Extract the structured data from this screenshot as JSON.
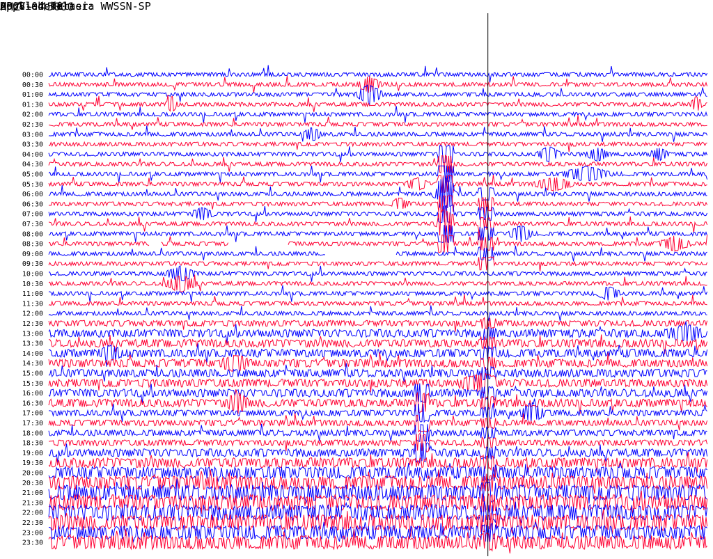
{
  "header": {
    "station": "HP Vlahokerasia",
    "date": "2008-04-08",
    "filter": "Applied filter: WWSSN-SP"
  },
  "channel_label": "HHZ - 45000",
  "colors": {
    "trace_a": "#0000ff",
    "trace_b": "#ff0033",
    "marker": "#000000"
  },
  "chart_data": {
    "type": "line",
    "title": "HP Vlahokerasia",
    "ylabel": "HHZ - 45000",
    "y_tick_labels": [
      "00:00",
      "00:30",
      "01:00",
      "01:30",
      "02:00",
      "02:30",
      "03:00",
      "03:30",
      "04:00",
      "04:30",
      "05:00",
      "05:30",
      "06:00",
      "06:30",
      "07:00",
      "07:30",
      "08:00",
      "08:30",
      "09:00",
      "09:30",
      "10:00",
      "10:30",
      "11:00",
      "11:30",
      "12:00",
      "12:30",
      "13:00",
      "13:30",
      "14:00",
      "14:30",
      "15:00",
      "15:30",
      "16:00",
      "16:30",
      "17:00",
      "17:30",
      "18:00",
      "18:30",
      "19:00",
      "19:30",
      "20:00",
      "20:30",
      "21:00",
      "21:30",
      "22:00",
      "22:30",
      "23:00",
      "23:30"
    ],
    "x_range_minutes": [
      0,
      30
    ],
    "rows": 48,
    "alternate_colors": [
      "#0000ff",
      "#ff0033"
    ],
    "noise_by_row": [
      2,
      2,
      2,
      2,
      2,
      2,
      2,
      2,
      2,
      2,
      2,
      2,
      2,
      2,
      2,
      2,
      2,
      2,
      2,
      2,
      2,
      2,
      2,
      2,
      2,
      3,
      4,
      4,
      4,
      4,
      4,
      4,
      4,
      4,
      3,
      3,
      3,
      3,
      4,
      5,
      6,
      7,
      8,
      8,
      8,
      8,
      7,
      7
    ],
    "events": [
      {
        "row": 1,
        "minute": 14.6,
        "amp": 10,
        "width": 0.6
      },
      {
        "row": 2,
        "minute": 14.6,
        "amp": 12,
        "width": 0.7
      },
      {
        "row": 3,
        "minute": 5.6,
        "amp": 10,
        "width": 0.3
      },
      {
        "row": 3,
        "minute": 29.5,
        "amp": 10,
        "width": 0.3
      },
      {
        "row": 6,
        "minute": 12.0,
        "amp": 8,
        "width": 0.5
      },
      {
        "row": 8,
        "minute": 22.8,
        "amp": 9,
        "width": 0.6
      },
      {
        "row": 8,
        "minute": 25.0,
        "amp": 8,
        "width": 0.6
      },
      {
        "row": 8,
        "minute": 27.8,
        "amp": 7,
        "width": 0.5
      },
      {
        "row": 10,
        "minute": 24.5,
        "amp": 9,
        "width": 1.2
      },
      {
        "row": 11,
        "minute": 23.0,
        "amp": 8,
        "width": 1.0
      },
      {
        "row": 11,
        "minute": 16.8,
        "amp": 7,
        "width": 0.6
      },
      {
        "row": 12,
        "minute": 18.0,
        "amp": 12,
        "width": 0.6
      },
      {
        "row": 13,
        "minute": 16.0,
        "amp": 7,
        "width": 0.5
      },
      {
        "row": 14,
        "minute": 7.0,
        "amp": 7,
        "width": 0.6
      },
      {
        "row": 15,
        "minute": 18.0,
        "amp": 8,
        "width": 0.5
      },
      {
        "row": 16,
        "minute": 21.5,
        "amp": 10,
        "width": 0.6
      },
      {
        "row": 17,
        "minute": 28.5,
        "amp": 9,
        "width": 0.8
      },
      {
        "row": 20,
        "minute": 6.0,
        "amp": 9,
        "width": 0.8
      },
      {
        "row": 21,
        "minute": 6.0,
        "amp": 10,
        "width": 0.9
      },
      {
        "row": 22,
        "minute": 25.5,
        "amp": 8,
        "width": 0.6
      },
      {
        "row": 26,
        "minute": 29.0,
        "amp": 8,
        "width": 1.0
      },
      {
        "row": 28,
        "minute": 2.8,
        "amp": 8,
        "width": 0.6
      },
      {
        "row": 29,
        "minute": 8.5,
        "amp": 8,
        "width": 0.8
      },
      {
        "row": 31,
        "minute": 19.5,
        "amp": 8,
        "width": 1.0
      },
      {
        "row": 33,
        "minute": 8.6,
        "amp": 11,
        "width": 0.6
      },
      {
        "row": 34,
        "minute": 22.0,
        "amp": 12,
        "width": 0.6
      }
    ],
    "long_spikes": [
      {
        "minute": 18.1,
        "row_start": 8,
        "row_end": 17,
        "amp": 10
      },
      {
        "minute": 19.9,
        "row_start": 12,
        "row_end": 19,
        "amp": 7
      },
      {
        "minute": 17.0,
        "row_start": 32,
        "row_end": 38,
        "amp": 9
      },
      {
        "minute": 20.0,
        "row_start": 25,
        "row_end": 47,
        "amp": 4
      }
    ],
    "gaps": [
      {
        "row": 17,
        "minute_start": 8.2,
        "minute_end": 10.9
      },
      {
        "row": 18,
        "minute_start": 12.6,
        "minute_end": 15.8
      },
      {
        "row": 17,
        "minute_start": 4.6,
        "minute_end": 5.1
      }
    ],
    "vertical_markers_minute": [
      20.0
    ]
  }
}
